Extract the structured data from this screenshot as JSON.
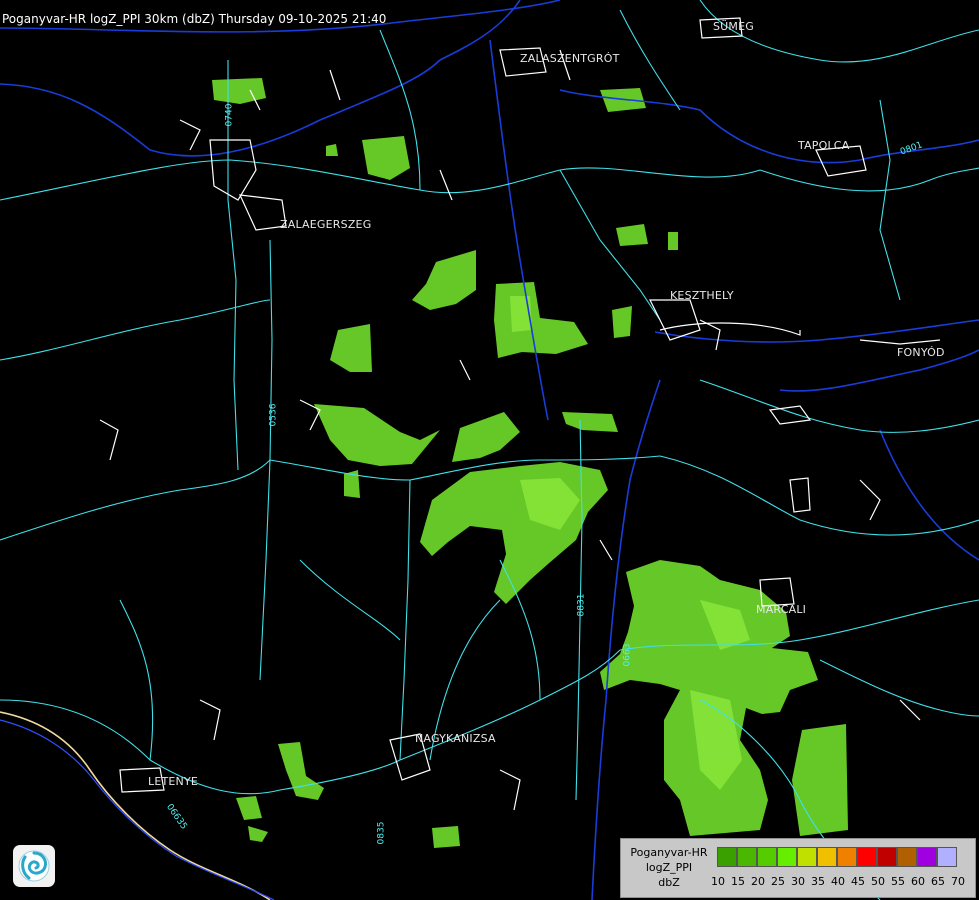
{
  "title": "Poganyvar-HR logZ_PPI 30km (dbZ) Thursday 09-10-2025 21:40",
  "cities": {
    "sumeg": "SÜMEG",
    "zalaszentgrot": "ZALASZENTGRÓT",
    "tapolca": "TAPOLCA",
    "zalaegerszeg": "ZALAEGERSZEG",
    "keszthely": "KESZTHELY",
    "fonyod": "FONYÓD",
    "marcali": "MARCALI",
    "nagykanizsa": "NAGYKANIZSA",
    "letenye": "LETENYE"
  },
  "roads": {
    "r0740": "0740",
    "r0536": "0536",
    "r8831": "8831",
    "r0663": "0663",
    "r06635": "06635",
    "r0835": "0835",
    "r0801": "0801"
  },
  "legend": {
    "line1": "Poganyvar-HR",
    "line2": "logZ_PPI",
    "line3": "dbZ",
    "colors": [
      "#3aa000",
      "#4ab800",
      "#55cc00",
      "#66ee00",
      "#c0e000",
      "#f0c000",
      "#f08000",
      "#ff0000",
      "#c00000",
      "#b06000",
      "#a000e0",
      "#b0b0ff"
    ],
    "ticks": [
      "10",
      "15",
      "20",
      "25",
      "30",
      "35",
      "40",
      "45",
      "50",
      "55",
      "60",
      "65",
      "70"
    ]
  },
  "precip_color": "#66cc22"
}
